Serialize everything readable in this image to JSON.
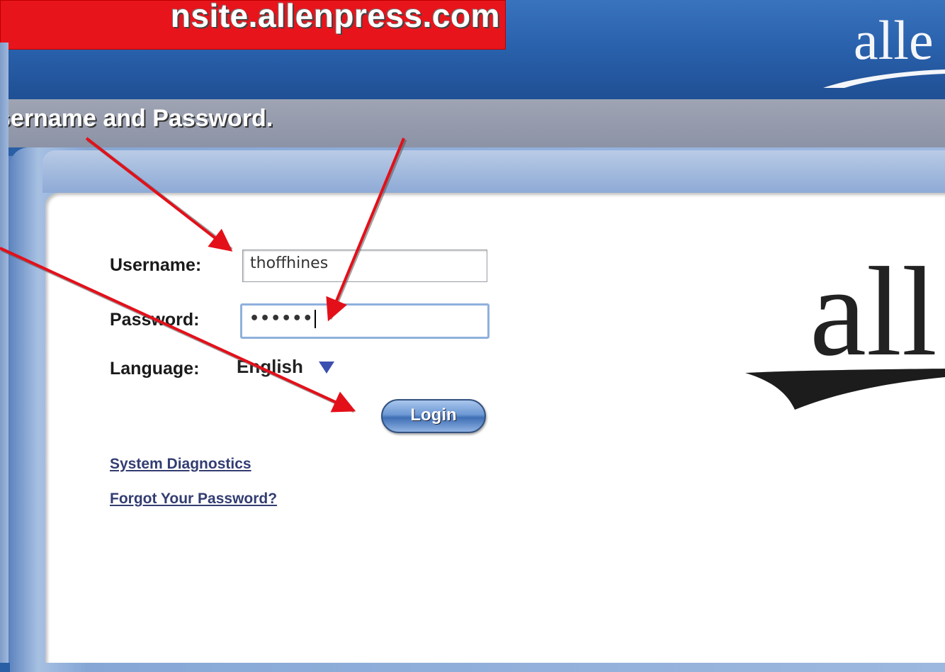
{
  "banner": {
    "url_text": "nsite.allenpress.com"
  },
  "instruction": {
    "text": "sername and Password."
  },
  "header": {
    "logo_text": "alle"
  },
  "login_form": {
    "username_label": "Username:",
    "username_value": "thoffhines",
    "password_label": "Password:",
    "password_value": "••••••",
    "language_label": "Language:",
    "language_value": "English",
    "login_button": "Login",
    "system_diagnostics_link": "System Diagnostics",
    "forgot_password_link": "Forgot Your Password?"
  },
  "brand": {
    "logo_text": "all"
  },
  "colors": {
    "banner_red": "#e8141c",
    "header_blue": "#2a62ad",
    "arrow_red": "#e3101a",
    "link_color": "#333d72"
  },
  "icons": {
    "language_dropdown": "chevron-down-icon"
  }
}
